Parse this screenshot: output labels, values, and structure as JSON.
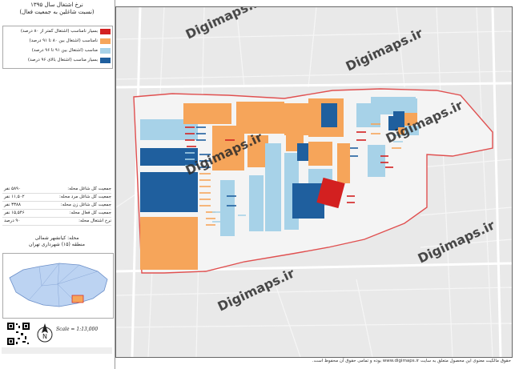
{
  "title": {
    "line1": "نرخ اشتغال سال ۱۳۹۵",
    "line2": "(نسبت شاغلین به جمعیت فعال)"
  },
  "legend": [
    {
      "label": "بسیار نامناسب (اشتغال کمتر از ۸۰ درصد)",
      "color": "#d32020"
    },
    {
      "label": "نامناسب (اشتغال بین ۸۰ تا ۹۱ درصد)",
      "color": "#f6a55a"
    },
    {
      "label": "مناسب (اشتغال بین ۹۱ تا ۹۶ درصد)",
      "color": "#a7d2e8"
    },
    {
      "label": "بسیار مناسب (اشتغال بالای ۹۶ درصد)",
      "color": "#1f5f9e"
    }
  ],
  "stats": [
    {
      "label": "جمعیت کل شاغل محله:",
      "value": "۵۸۹۰ نفر"
    },
    {
      "label": "جمعیت کل شاغل مرد محله:",
      "value": "۱۱,۵۰۲ نفر"
    },
    {
      "label": "جمعیت کل شاغل زن محله:",
      "value": "۳۳۸۸ نفر"
    },
    {
      "label": "جمعیت کل فعال محله:",
      "value": "۱۵,۵۴۶ نفر"
    },
    {
      "label": "نرخ اشتغال محله:",
      "value": "۹۰ درصد"
    }
  ],
  "area": {
    "neighborhood": "محله: کیانشهر شمالی",
    "district": "منطقه (۱۵) شهرداری تهران"
  },
  "scale": "Scale = 1:13,000",
  "north_label": "N",
  "watermark": "Digimaps.ir",
  "footer": "حقوق مالکیت معنوی این محصول متعلق به سایت www.digimaps.ir بوده و تمامی حقوق آن محفوظ است.",
  "colors": {
    "very_poor": "#d32020",
    "poor": "#f6a55a",
    "good": "#a7d2e8",
    "very_good": "#1f5f9e",
    "boundary": "#e05050",
    "base": "#e9e9e9"
  }
}
